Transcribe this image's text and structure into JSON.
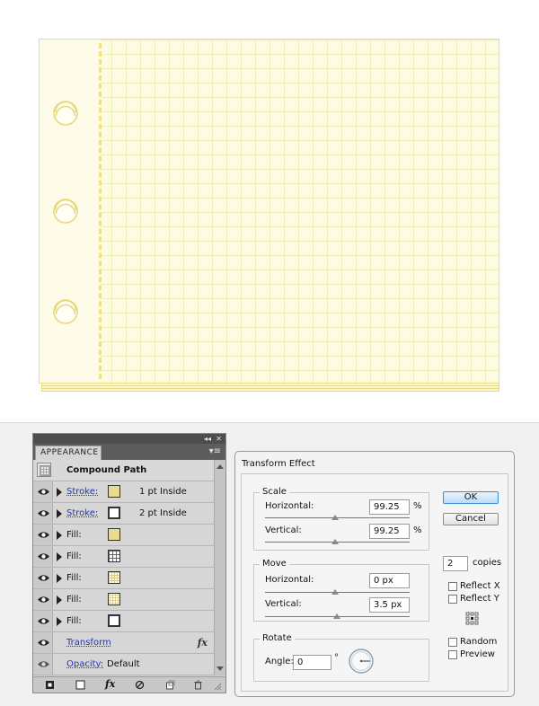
{
  "appearance": {
    "tab_label": "APPEARANCE",
    "collapse_label": "◂◂",
    "close_label": "✕",
    "menu_label": "▾≡",
    "header": "Compound Path",
    "rows": [
      {
        "type": "Stroke:",
        "meta": "1 pt  Inside",
        "swatch": "#e9dc8c"
      },
      {
        "type": "Stroke:",
        "meta": "2 pt  Inside",
        "swatch": "#ffffff"
      },
      {
        "type": "Fill:",
        "swatch": "#e9dc8c"
      },
      {
        "type": "Fill:",
        "swatch": "grid"
      },
      {
        "type": "Fill:",
        "swatch": "grid-fine"
      },
      {
        "type": "Fill:",
        "swatch": "dots"
      },
      {
        "type": "Fill:",
        "swatch": "#ffffff"
      }
    ],
    "transform_label": "Transform",
    "opacity_label": "Opacity:",
    "opacity_value": "Default",
    "fx_symbol": "fx"
  },
  "dialog": {
    "title": "Transform Effect",
    "scale": {
      "title": "Scale",
      "horizontal_label": "Horizontal:",
      "horizontal_value": "99.25",
      "vertical_label": "Vertical:",
      "vertical_value": "99.25",
      "unit": "%"
    },
    "move": {
      "title": "Move",
      "horizontal_label": "Horizontal:",
      "horizontal_value": "0 px",
      "vertical_label": "Vertical:",
      "vertical_value": "3.5 px"
    },
    "rotate": {
      "title": "Rotate",
      "angle_label": "Angle:",
      "angle_value": "0",
      "angle_unit": "°"
    },
    "ok_label": "OK",
    "cancel_label": "Cancel",
    "copies_value": "2",
    "copies_label": "copies",
    "reflect_x_label": "Reflect X",
    "reflect_y_label": "Reflect Y",
    "random_label": "Random",
    "preview_label": "Preview"
  },
  "colors": {
    "paper": "#fefce0",
    "paper_border": "#e9dc8c",
    "link": "#1a37c8",
    "ok_accent": "#3a8ad6"
  }
}
